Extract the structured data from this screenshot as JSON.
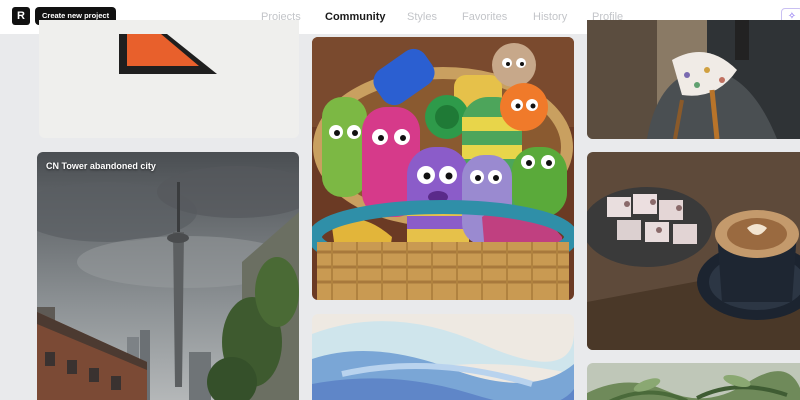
{
  "app": {
    "logo_letter": "R",
    "create_button": "Create new project"
  },
  "nav": {
    "items": [
      "Projects",
      "Community",
      "Styles",
      "Favorites",
      "History",
      "Profile"
    ],
    "active": "Community",
    "corner_icon": "sparkle-icon"
  },
  "feed": {
    "cards": [
      {
        "title": ""
      },
      {
        "title": "CN Tower abandoned city"
      },
      {
        "title": ""
      },
      {
        "title": ""
      },
      {
        "title": ""
      },
      {
        "title": ""
      },
      {
        "title": ""
      }
    ]
  },
  "colors": {
    "accent": "#7a5cf0",
    "nav_active": "#1a1a1a",
    "nav_inactive": "#c3c5c9",
    "background": "#e9eaec"
  }
}
